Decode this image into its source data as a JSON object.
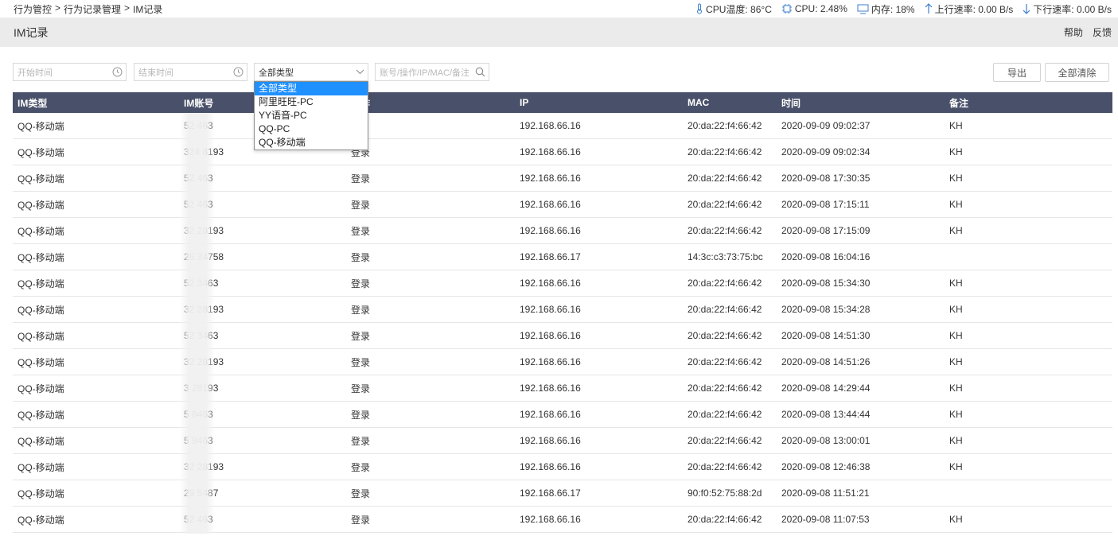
{
  "breadcrumb": [
    "行为管控",
    ">",
    "行为记录管理",
    ">",
    "IM记录"
  ],
  "status": {
    "cpu_temp": "CPU温度: 86°C",
    "cpu": "CPU: 2.48%",
    "memory": "内存: 18%",
    "upload": "上行速率: 0.00 B/s",
    "download": "下行速率: 0.00 B/s"
  },
  "page_title": "IM记录",
  "title_links": {
    "help": "帮助",
    "feedback": "反馈"
  },
  "filters": {
    "start_placeholder": "开始时间",
    "end_placeholder": "结束时间",
    "type_selected": "全部类型",
    "search_placeholder": "账号/操作/IP/MAC/备注"
  },
  "buttons": {
    "export": "导出",
    "clear_all": "全部清除"
  },
  "dropdown_options": [
    "全部类型",
    "阿里旺旺-PC",
    "YY语音-PC",
    "QQ-PC",
    "QQ-移动端"
  ],
  "columns": [
    "IM类型",
    "IM账号",
    "操作",
    "IP",
    "MAC",
    "时间",
    "备注"
  ],
  "rows": [
    [
      "QQ-移动端",
      "52     463",
      "",
      "192.168.66.16",
      "20:da:22:f4:66:42",
      "2020-09-09 09:02:37",
      "KH"
    ],
    [
      "QQ-移动端",
      "324     8193",
      "登录",
      "192.168.66.16",
      "20:da:22:f4:66:42",
      "2020-09-09 09:02:34",
      "KH"
    ],
    [
      "QQ-移动端",
      "52     463",
      "登录",
      "192.168.66.16",
      "20:da:22:f4:66:42",
      "2020-09-08 17:30:35",
      "KH"
    ],
    [
      "QQ-移动端",
      "52     463",
      "登录",
      "192.168.66.16",
      "20:da:22:f4:66:42",
      "2020-09-08 17:15:11",
      "KH"
    ],
    [
      "QQ-移动端",
      "32     28193",
      "登录",
      "192.168.66.16",
      "20:da:22:f4:66:42",
      "2020-09-08 17:15:09",
      "KH"
    ],
    [
      "QQ-移动端",
      "26     34758",
      "登录",
      "192.168.66.17",
      "14:3c:c3:73:75:bc",
      "2020-09-08 16:04:16",
      ""
    ],
    [
      "QQ-移动端",
      "52     3463",
      "登录",
      "192.168.66.16",
      "20:da:22:f4:66:42",
      "2020-09-08 15:34:30",
      "KH"
    ],
    [
      "QQ-移动端",
      "32     28193",
      "登录",
      "192.168.66.16",
      "20:da:22:f4:66:42",
      "2020-09-08 15:34:28",
      "KH"
    ],
    [
      "QQ-移动端",
      "52     3463",
      "登录",
      "192.168.66.16",
      "20:da:22:f4:66:42",
      "2020-09-08 14:51:30",
      "KH"
    ],
    [
      "QQ-移动端",
      "32     28193",
      "登录",
      "192.168.66.16",
      "20:da:22:f4:66:42",
      "2020-09-08 14:51:26",
      "KH"
    ],
    [
      "QQ-移动端",
      "3     28193",
      "登录",
      "192.168.66.16",
      "20:da:22:f4:66:42",
      "2020-09-08 14:29:44",
      "KH"
    ],
    [
      "QQ-移动端",
      "5     8463",
      "登录",
      "192.168.66.16",
      "20:da:22:f4:66:42",
      "2020-09-08 13:44:44",
      "KH"
    ],
    [
      "QQ-移动端",
      "5     8463",
      "登录",
      "192.168.66.16",
      "20:da:22:f4:66:42",
      "2020-09-08 13:00:01",
      "KH"
    ],
    [
      "QQ-移动端",
      "32     28193",
      "登录",
      "192.168.66.16",
      "20:da:22:f4:66:42",
      "2020-09-08 12:46:38",
      "KH"
    ],
    [
      "QQ-移动端",
      "29     5487",
      "登录",
      "192.168.66.17",
      "90:f0:52:75:88:2d",
      "2020-09-08 11:51:21",
      ""
    ],
    [
      "QQ-移动端",
      "52     463",
      "登录",
      "192.168.66.16",
      "20:da:22:f4:66:42",
      "2020-09-08 11:07:53",
      "KH"
    ]
  ],
  "colors": {
    "header_bg": "#495069",
    "titlebar_bg": "#ebebeb",
    "selected_option": "#1e90ff",
    "icon_blue": "#3c7fd0"
  }
}
